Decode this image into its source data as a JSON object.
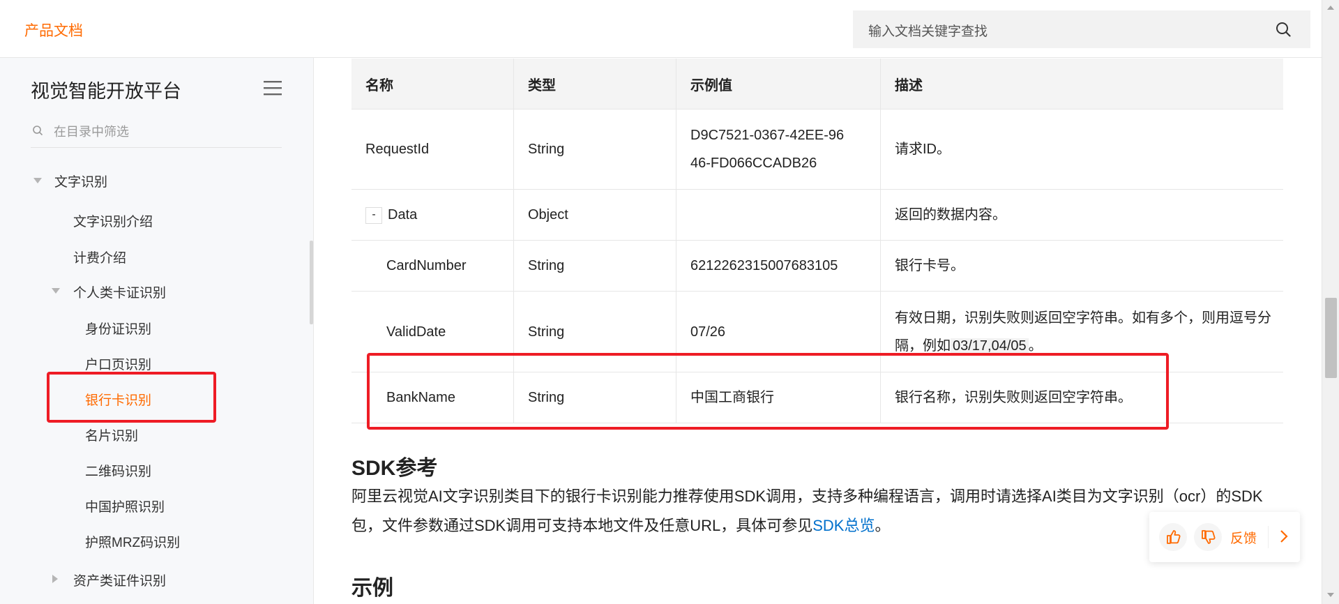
{
  "topbar": {
    "logo": "产品文档",
    "search_placeholder": "输入文档关键字查找",
    "search_icon": "search-icon"
  },
  "sidebar": {
    "title": "视觉智能开放平台",
    "menu_icon": "hamburger-menu-icon",
    "filter_placeholder": "在目录中筛选",
    "items": [
      {
        "label": "文字识别",
        "expanded": true
      },
      {
        "label": "文字识别介绍"
      },
      {
        "label": "计费介绍"
      },
      {
        "label": "个人类卡证识别",
        "expanded": true
      },
      {
        "label": "身份证识别"
      },
      {
        "label": "户口页识别"
      },
      {
        "label": "银行卡识别",
        "active": true
      },
      {
        "label": "名片识别"
      },
      {
        "label": "二维码识别"
      },
      {
        "label": "中国护照识别"
      },
      {
        "label": "护照MRZ码识别"
      },
      {
        "label": "资产类证件识别",
        "expanded": false
      }
    ],
    "active_color": "#ff6a00"
  },
  "table": {
    "headers": [
      "名称",
      "类型",
      "示例值",
      "描述"
    ],
    "rows": [
      {
        "name": "RequestId",
        "type": "String",
        "example": "D9C7521-0367-42EE-9646-FD066CCADB26",
        "desc": "请求ID。"
      },
      {
        "name": "Data",
        "toggle": "-",
        "type": "Object",
        "example": "",
        "desc": "返回的数据内容。"
      },
      {
        "name": "CardNumber",
        "type": "String",
        "example": "6212262315007683105",
        "desc": "银行卡号。"
      },
      {
        "name": "ValidDate",
        "type": "String",
        "example": "07/26",
        "desc_pre": "有效日期，识别失败则返回空字符串。如有多个，则用逗号分隔，例如",
        "desc_code": "03/17,04/05",
        "desc_post": "。"
      },
      {
        "name": "BankName",
        "type": "String",
        "example": "中国工商银行",
        "desc": "银行名称，识别失败则返回空字符串。"
      }
    ]
  },
  "sdk": {
    "heading": "SDK参考",
    "para_text": "阿里云视觉AI文字识别类目下的银行卡识别能力推荐使用SDK调用，支持多种编程语言，调用时请选择AI类目为文字识别（ocr）的SDK包，文件参数通过SDK调用可支持本地文件及任意URL，具体可参见",
    "link": "SDK总览",
    "para_end": "。"
  },
  "example_heading": "示例",
  "feedback": {
    "label": "反馈",
    "like_icon": "thumbs-up-icon",
    "dislike_icon": "thumbs-down-icon",
    "arrow_icon": "chevron-right-icon"
  },
  "colors": {
    "accent": "#ff6a00",
    "link": "#0070cc",
    "highlight": "#ee1c25"
  }
}
